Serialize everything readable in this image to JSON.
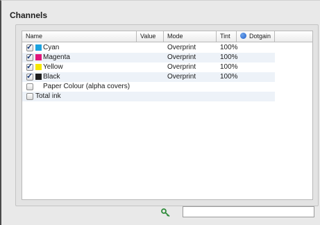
{
  "panel": {
    "title": "Channels"
  },
  "columns": [
    {
      "label": "Name"
    },
    {
      "label": "Value"
    },
    {
      "label": "Mode"
    },
    {
      "label": "Tint"
    },
    {
      "label": "Dotgain"
    }
  ],
  "rows": [
    {
      "checked": true,
      "swatch_color": "#1aa2df",
      "name": "Cyan",
      "value": "",
      "mode": "Overprint",
      "tint": "100%"
    },
    {
      "checked": true,
      "swatch_color": "#e0177b",
      "name": "Magenta",
      "value": "",
      "mode": "Overprint",
      "tint": "100%"
    },
    {
      "checked": true,
      "swatch_color": "#f5e600",
      "name": "Yellow",
      "value": "",
      "mode": "Overprint",
      "tint": "100%"
    },
    {
      "checked": true,
      "swatch_color": "#1e1e1e",
      "name": "Black",
      "value": "",
      "mode": "Overprint",
      "tint": "100%"
    },
    {
      "checked": false,
      "swatch_color": null,
      "name": "Paper Colour (alpha covers)",
      "value": "",
      "mode": "",
      "tint": ""
    },
    {
      "checked": false,
      "swatch_color": null,
      "name": "Total ink",
      "value": "",
      "mode": "",
      "tint": ""
    }
  ],
  "search": {
    "value": "",
    "placeholder": ""
  },
  "icons": {
    "search": "search-key-icon",
    "dotgain": "blue-dot-icon",
    "check": "checkmark-icon"
  },
  "colors": {
    "dotgain_dot": "#2d6fd6",
    "row_alt": "#edf2f8",
    "search_icon": "#2e8b3a"
  }
}
